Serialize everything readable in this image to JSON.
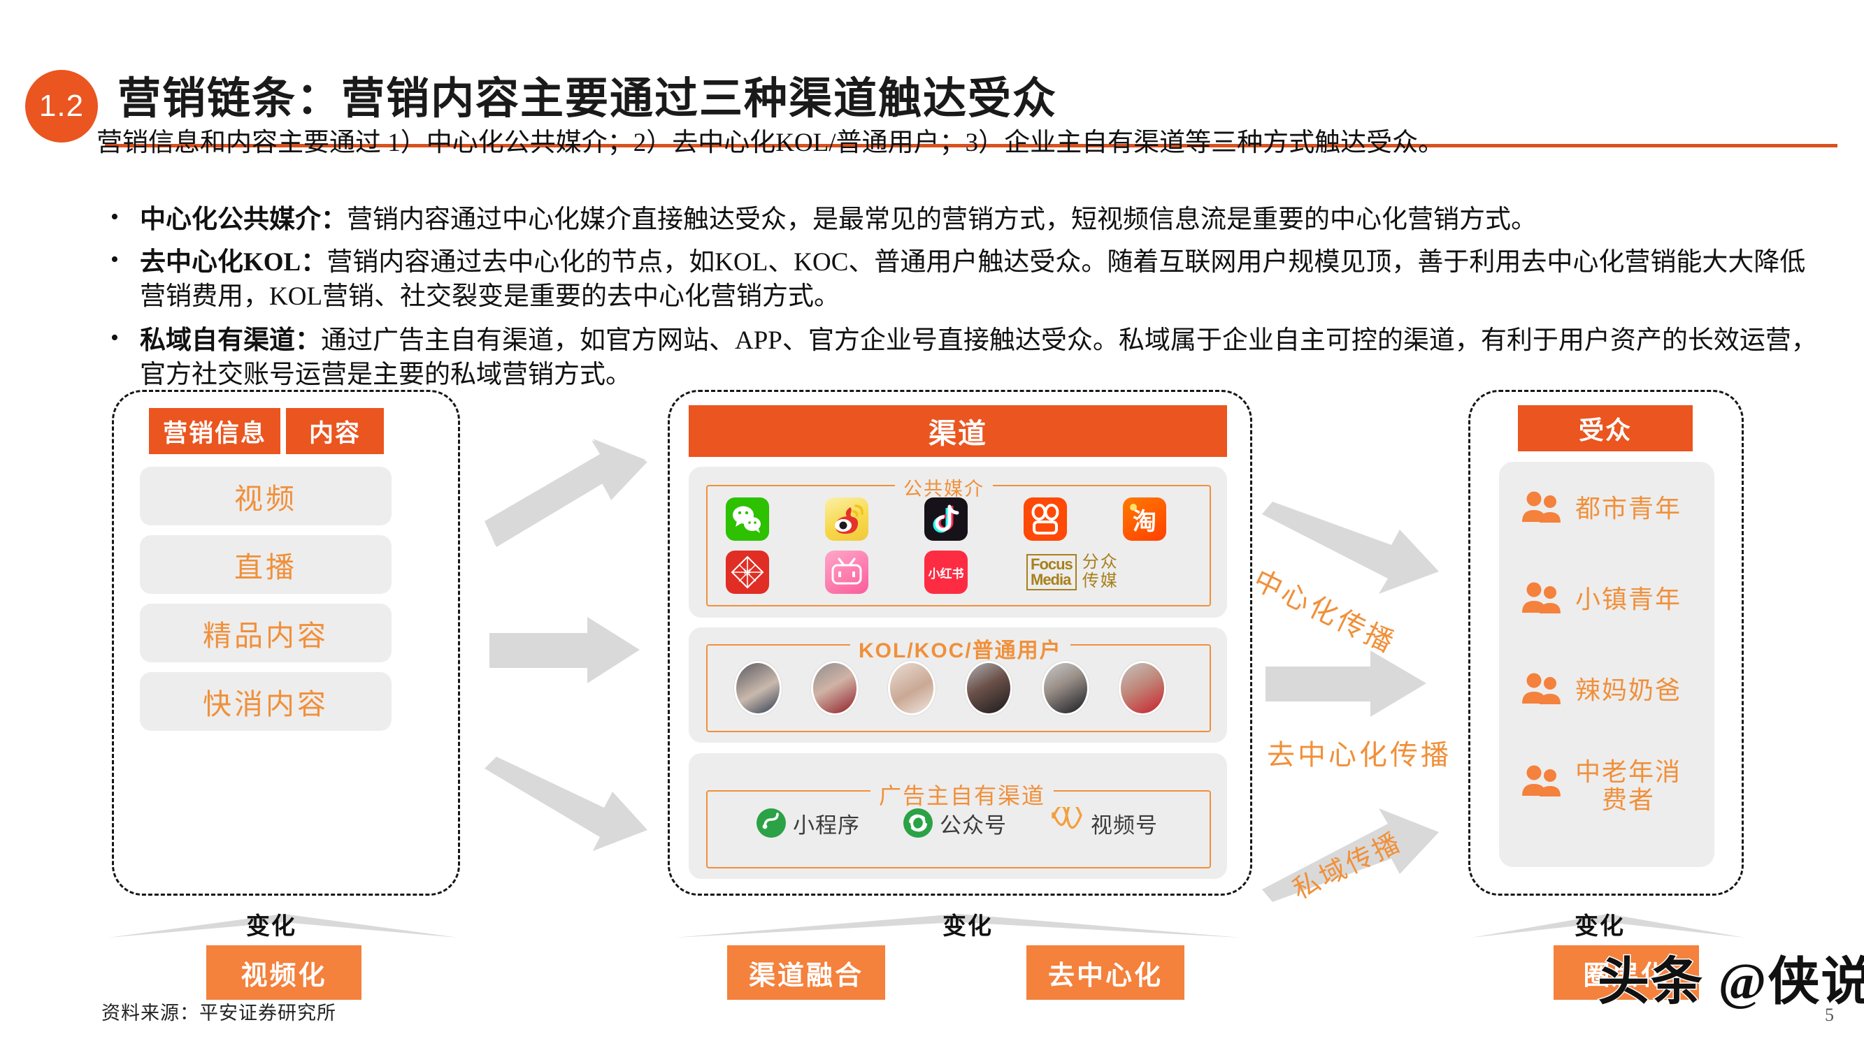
{
  "header": {
    "number_badge": "1.2",
    "title": "营销链条：营销内容主要通过三种渠道触达受众"
  },
  "body": {
    "lead": "营销信息和内容主要通过 1）中心化公共媒介；2）去中心化KOL/普通用户；3）企业主自有渠道等三种方式触达受众。",
    "bullets": [
      {
        "term": "中心化公共媒介：",
        "text": "营销内容通过中心化媒介直接触达受众，是最常见的营销方式，短视频信息流是重要的中心化营销方式。"
      },
      {
        "term": "去中心化KOL：",
        "text": "营销内容通过去中心化的节点，如KOL、KOC、普通用户触达受众。随着互联网用户规模见顶，善于利用去中心化营销能大大降低营销费用，KOL营销、社交裂变是重要的去中心化营销方式。"
      },
      {
        "term": "私域自有渠道：",
        "text": "通过广告主自有渠道，如官方网站、APP、官方企业号直接触达受众。私域属于企业自主可控的渠道，有利于用户资产的长效运营，官方社交账号运营是主要的私域营销方式。"
      }
    ]
  },
  "diagram": {
    "left": {
      "head_left": "营销信息",
      "head_right": "内容",
      "cards": [
        "视频",
        "直播",
        "精品内容",
        "快消内容"
      ],
      "change_label": "变化",
      "tag": "视频化"
    },
    "middle": {
      "head": "渠道",
      "public_media": {
        "legend": "公共媒介",
        "logos": [
          {
            "name": "wechat-logo",
            "text": "",
            "bg": "#2DC100"
          },
          {
            "name": "weibo-logo",
            "text": "",
            "bg": "#F5D04A"
          },
          {
            "name": "douyin-logo",
            "text": "",
            "bg": "#17121A"
          },
          {
            "name": "kuaishou-logo",
            "text": "",
            "bg": "#FF4906"
          },
          {
            "name": "taobao-logo",
            "text": "淘",
            "bg": "#FF5000"
          },
          {
            "name": "pinduoduo-logo",
            "text": "",
            "bg": "#E02E24"
          },
          {
            "name": "bilibili-logo",
            "text": "bilibili",
            "bg": "#FB7299"
          },
          {
            "name": "xiaohongshu-logo",
            "text": "小红书",
            "bg": "#FE2C55"
          },
          {
            "name": "focus-media-logo",
            "text": "Focus Media",
            "bg": "#FFFFFF",
            "cn": "分众传媒"
          }
        ]
      },
      "kol": {
        "legend": "KOL/KOC/普通用户",
        "avatar_count": 6
      },
      "owned": {
        "legend": "广告主自有渠道",
        "items": [
          {
            "icon": "mini-program-icon",
            "label": "小程序",
            "color": "#2BA245"
          },
          {
            "icon": "official-account-icon",
            "label": "公众号",
            "color": "#2BA245"
          },
          {
            "icon": "channels-icon",
            "label": "视频号",
            "color": "#F2A03D"
          }
        ]
      },
      "change_label": "变化",
      "tag_left": "渠道融合",
      "tag_right": "去中心化"
    },
    "right": {
      "head": "受众",
      "audiences": [
        "都市青年",
        "小镇青年",
        "辣妈奶爸",
        "中老年消\n费者"
      ],
      "change_label": "变化",
      "tag": "圈层化"
    },
    "flow_labels": [
      "中心化传播",
      "去中心化传播",
      "私域传播"
    ]
  },
  "footer": {
    "source": "资料来源：平安证券研究所",
    "page": "5",
    "watermark": "头条 @侠说"
  },
  "colors": {
    "orange_primary": "#EA5520",
    "orange_light": "#F4813C",
    "orange_text": "#F0903A",
    "grey_card": "#EDEDEE",
    "rule": "#D8511E"
  }
}
